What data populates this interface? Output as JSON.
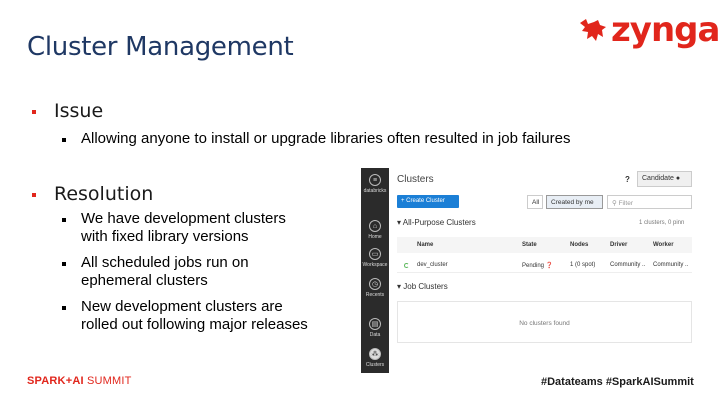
{
  "slide": {
    "title": "Cluster Management",
    "logo_text": "zynga",
    "sections": [
      {
        "heading": "Issue",
        "items": [
          "Allowing anyone to install or upgrade libraries often resulted in job failures"
        ]
      },
      {
        "heading": "Resolution",
        "items": [
          [
            "We have development clusters",
            "with fixed library versions"
          ],
          [
            "All scheduled jobs run on",
            "ephemeral clusters"
          ],
          [
            "New development clusters are",
            "rolled out following major releases"
          ]
        ]
      }
    ],
    "footer_left_bold": "SPARK+AI",
    "footer_left_thin": "SUMMIT",
    "footer_right": "#Datateams  #SparkAISummit"
  },
  "databricks": {
    "sidebar": {
      "brand": "databricks",
      "items": [
        "Home",
        "Workspace",
        "Recents",
        "Data",
        "Clusters"
      ]
    },
    "title": "Clusters",
    "help": "?",
    "user_button": "Candidate",
    "create_button": "+ Create Cluster",
    "filter_all": "All",
    "filter_mine": "Created by me",
    "filter_placeholder": "Filter",
    "all_purpose_heading": "All-Purpose Clusters",
    "all_purpose_count": "1 clusters, 0 pinn",
    "columns": [
      "Name",
      "State",
      "Nodes",
      "Driver",
      "Worker"
    ],
    "rows": [
      {
        "name": "dev_cluster",
        "state": "Pending",
        "nodes": "1 (0 spot)",
        "driver": "Community ..",
        "worker": "Community .."
      }
    ],
    "job_heading": "Job Clusters",
    "job_empty": "No clusters found"
  },
  "colors": {
    "title": "#1f3864",
    "brand_red": "#e1261c",
    "primary_blue": "#1b7fd6"
  }
}
